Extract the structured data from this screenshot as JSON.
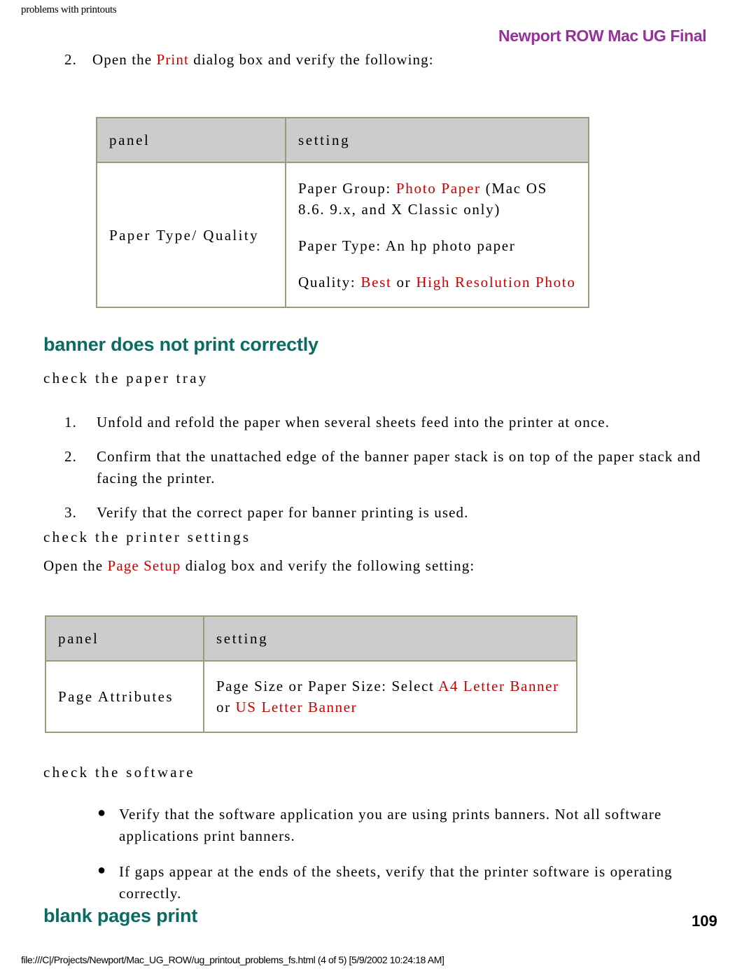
{
  "running_head": {
    "left": "problems with printouts",
    "right": "Newport ROW Mac UG Final",
    "right_color": "#96309a"
  },
  "accent_colors": {
    "heading_green": "#0a6b63",
    "emphasis_red": "#cc0000",
    "table_border": "#9a9a7c",
    "table_header_fill": "#cccccc"
  },
  "step_top": {
    "number": "2.",
    "text_before": "Open the ",
    "emphasis": "Print",
    "text_after": " dialog box and verify the following:"
  },
  "table1": {
    "headers": [
      "panel",
      "setting"
    ],
    "row": {
      "panel": "Paper Type/ Quality",
      "setting_lines": [
        {
          "label": "Paper Group: ",
          "emphasis": "Photo Paper",
          "tail": " (Mac OS 8.6. 9.x, and X Classic only)"
        },
        {
          "label": "Paper Type: An hp photo paper",
          "emphasis": "",
          "tail": ""
        },
        {
          "label": "Quality: ",
          "emphasis": "Best",
          "mid": " or ",
          "emphasis2": "High Resolution Photo",
          "tail": ""
        }
      ]
    }
  },
  "section_banner": {
    "heading": "banner does not print correctly",
    "sub_tray": "check the paper tray",
    "steps": [
      {
        "number": "1.",
        "text": "Unfold and refold the paper when several sheets feed into the printer at once."
      },
      {
        "number": "2.",
        "text": "Confirm that the unattached edge of the banner paper stack is on top of the paper stack and facing the printer."
      },
      {
        "number": "3.",
        "text": "Verify that the correct paper for banner printing is used."
      }
    ],
    "sub_settings": "check the printer settings",
    "pagesetup_line": {
      "text_before": "Open the ",
      "emphasis": "Page Setup",
      "text_after": " dialog box and verify the following setting:"
    },
    "sub_software": "check the software",
    "bullets": [
      {
        "marker": "●",
        "text": "Verify that the software application you are using prints banners. Not all software applications print banners."
      },
      {
        "marker": "●",
        "text": "If gaps appear at the ends of the sheets, verify that the printer software is operating correctly."
      }
    ]
  },
  "table2": {
    "headers": [
      "panel",
      "setting"
    ],
    "row": {
      "panel": "Page Attributes",
      "setting": {
        "label": "Page Size or Paper Size: Select ",
        "emphasis": "A4 Letter Banner",
        "mid": " or ",
        "emphasis2": "US Letter Banner"
      }
    }
  },
  "section_blank": {
    "heading": "blank pages print"
  },
  "page_number": "109",
  "footer": {
    "path": "file:///C|/Projects/Newport/Mac_UG_ROW/ug_printout_problems_fs.html (4 of 5) [5/9/2002 10:24:18 AM]"
  }
}
